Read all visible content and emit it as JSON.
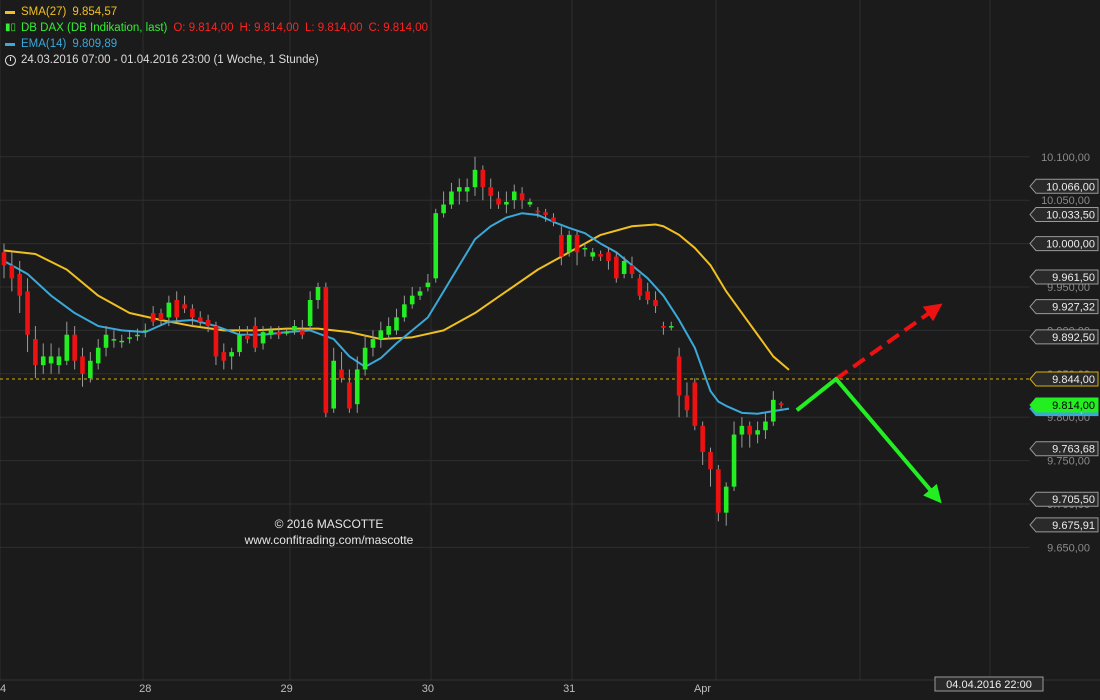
{
  "legend": {
    "sma_label": "SMA(27)",
    "sma_value": "9.854,57",
    "instrument": "DB DAX (DB Indikation, last)",
    "ohlc": {
      "open": "O: 9.814,00",
      "high": "H: 9.814,00",
      "low": "L: 9.814,00",
      "close": "C: 9.814,00"
    },
    "ema_label": "EMA(14)",
    "ema_value": "9.809,89",
    "range": "24.03.2016 07:00 - 01.04.2016 23:00 (1 Woche, 1 Stunde)"
  },
  "watermark": {
    "line1": "© 2016 MASCOTTE",
    "line2": "www.confitrading.com/mascotte"
  },
  "colors": {
    "background": "#1b1b1b",
    "up": "#22ee22",
    "down": "#ee1111",
    "sma": "#f0c020",
    "ema": "#3aa8d8",
    "reference_line": "#d9b000",
    "scenario_up": "#ee1111",
    "scenario_down": "#22ee22"
  },
  "chart_data": {
    "type": "candlestick",
    "ylim": [
      9630,
      10110
    ],
    "y_ticks": [
      {
        "value": 10100,
        "label": "10.100,00"
      },
      {
        "value": 10050,
        "label": "10.050,00"
      },
      {
        "value": 10000,
        "label": "10.000,00"
      },
      {
        "value": 9950,
        "label": "9.950,00"
      },
      {
        "value": 9900,
        "label": "9.900,00"
      },
      {
        "value": 9850,
        "label": "9.850,00"
      },
      {
        "value": 9800,
        "label": "9.800,00"
      },
      {
        "value": 9750,
        "label": "9.750,00"
      },
      {
        "value": 9700,
        "label": "9.700,00"
      },
      {
        "value": 9650,
        "label": "9.650,00"
      }
    ],
    "price_levels": [
      {
        "value": 10066,
        "label": "10.066,00"
      },
      {
        "value": 10033.5,
        "label": "10.033,50"
      },
      {
        "value": 10000,
        "label": "10.000,00"
      },
      {
        "value": 9961.5,
        "label": "9.961,50"
      },
      {
        "value": 9927.32,
        "label": "9.927,32"
      },
      {
        "value": 9892.5,
        "label": "9.892,50"
      },
      {
        "value": 9844,
        "label": "9.844,00"
      },
      {
        "value": 9809.91,
        "label": "9.809,91"
      },
      {
        "value": 9814,
        "label": "9.814,00"
      },
      {
        "value": 9763.68,
        "label": "9.763,68"
      },
      {
        "value": 9705.5,
        "label": "9.705,50"
      },
      {
        "value": 9675.91,
        "label": "9.675,91"
      }
    ],
    "x_labels": [
      {
        "index": 0,
        "label": "4"
      },
      {
        "index": 18,
        "label": "28"
      },
      {
        "index": 36,
        "label": "29"
      },
      {
        "index": 54,
        "label": "30"
      },
      {
        "index": 72,
        "label": "31"
      },
      {
        "index": 90,
        "label": "Apr"
      }
    ],
    "cursor_label": "04.04.2016 22:00",
    "reference_line": 9844,
    "candles": [
      [
        9990,
        9975,
        10000,
        9960
      ],
      [
        9975,
        9960,
        9990,
        9945
      ],
      [
        9965,
        9940,
        9980,
        9920
      ],
      [
        9945,
        9895,
        9960,
        9875
      ],
      [
        9890,
        9860,
        9905,
        9845
      ],
      [
        9860,
        9870,
        9885,
        9850
      ],
      [
        9862,
        9870,
        9885,
        9850
      ],
      [
        9860,
        9870,
        9880,
        9850
      ],
      [
        9865,
        9895,
        9910,
        9860
      ],
      [
        9895,
        9865,
        9905,
        9855
      ],
      [
        9870,
        9850,
        9880,
        9835
      ],
      [
        9845,
        9865,
        9875,
        9840
      ],
      [
        9862,
        9880,
        9890,
        9855
      ],
      [
        9880,
        9895,
        9905,
        9870
      ],
      [
        9890,
        9890,
        9900,
        9880
      ],
      [
        9888,
        9888,
        9895,
        9880
      ],
      [
        9892,
        9892,
        9900,
        9885
      ],
      [
        9895,
        9895,
        9902,
        9888
      ],
      [
        9900,
        9900,
        9908,
        9892
      ],
      [
        9920,
        9910,
        9928,
        9905
      ],
      [
        9920,
        9912,
        9925,
        9905
      ],
      [
        9915,
        9932,
        9940,
        9905
      ],
      [
        9935,
        9915,
        9945,
        9910
      ],
      [
        9930,
        9925,
        9940,
        9920
      ],
      [
        9925,
        9915,
        9930,
        9905
      ],
      [
        9915,
        9910,
        9922,
        9905
      ],
      [
        9912,
        9905,
        9918,
        9898
      ],
      [
        9905,
        9870,
        9910,
        9860
      ],
      [
        9875,
        9865,
        9885,
        9855
      ],
      [
        9870,
        9875,
        9880,
        9855
      ],
      [
        9875,
        9895,
        9905,
        9870
      ],
      [
        9895,
        9890,
        9905,
        9885
      ],
      [
        9905,
        9880,
        9915,
        9875
      ],
      [
        9885,
        9898,
        9905,
        9878
      ],
      [
        9895,
        9900,
        9905,
        9890
      ],
      [
        9898,
        9895,
        9905,
        9890
      ],
      [
        9898,
        9898,
        9902,
        9894
      ],
      [
        9900,
        9905,
        9912,
        9895
      ],
      [
        9900,
        9895,
        9912,
        9890
      ],
      [
        9905,
        9935,
        9945,
        9900
      ],
      [
        9935,
        9950,
        9955,
        9925
      ],
      [
        9950,
        9805,
        9955,
        9800
      ],
      [
        9810,
        9865,
        9880,
        9805
      ],
      [
        9855,
        9845,
        9875,
        9840
      ],
      [
        9840,
        9810,
        9855,
        9805
      ],
      [
        9815,
        9855,
        9870,
        9805
      ],
      [
        9855,
        9880,
        9895,
        9848
      ],
      [
        9880,
        9890,
        9900,
        9870
      ],
      [
        9890,
        9900,
        9910,
        9880
      ],
      [
        9895,
        9905,
        9915,
        9890
      ],
      [
        9900,
        9915,
        9925,
        9895
      ],
      [
        9915,
        9930,
        9940,
        9910
      ],
      [
        9930,
        9940,
        9950,
        9925
      ],
      [
        9940,
        9945,
        9950,
        9935
      ],
      [
        9950,
        9955,
        9965,
        9945
      ],
      [
        9960,
        10035,
        10040,
        9955
      ],
      [
        10035,
        10045,
        10060,
        10030
      ],
      [
        10045,
        10060,
        10070,
        10040
      ],
      [
        10060,
        10065,
        10075,
        10045
      ],
      [
        10060,
        10065,
        10075,
        10048
      ],
      [
        10065,
        10085,
        10100,
        10055
      ],
      [
        10085,
        10065,
        10090,
        10050
      ],
      [
        10065,
        10055,
        10075,
        10040
      ],
      [
        10052,
        10045,
        10060,
        10040
      ],
      [
        10045,
        10048,
        10060,
        10035
      ],
      [
        10050,
        10060,
        10068,
        10040
      ],
      [
        10058,
        10050,
        10065,
        10040
      ],
      [
        10045,
        10048,
        10052,
        10042
      ],
      [
        10038,
        10036,
        10042,
        10030
      ],
      [
        10036,
        10033,
        10040,
        10025
      ],
      [
        10030,
        10025,
        10035,
        10020
      ],
      [
        10010,
        9985,
        10020,
        9975
      ],
      [
        9990,
        10010,
        10015,
        9985
      ],
      [
        10010,
        9990,
        10015,
        9975
      ],
      [
        9995,
        9995,
        10000,
        9985
      ],
      [
        9985,
        9990,
        9995,
        9980
      ],
      [
        9988,
        9985,
        9992,
        9980
      ],
      [
        9990,
        9980,
        9995,
        9970
      ],
      [
        9985,
        9960,
        9990,
        9955
      ],
      [
        9965,
        9980,
        9985,
        9960
      ],
      [
        9975,
        9965,
        9985,
        9960
      ],
      [
        9960,
        9940,
        9965,
        9935
      ],
      [
        9945,
        9935,
        9955,
        9930
      ],
      [
        9935,
        9928,
        9945,
        9920
      ],
      [
        9905,
        9903,
        9910,
        9895
      ],
      [
        9905,
        9905,
        9910,
        9900
      ],
      [
        9870,
        9825,
        9880,
        9800
      ],
      [
        9825,
        9808,
        9840,
        9800
      ],
      [
        9840,
        9790,
        9845,
        9785
      ],
      [
        9790,
        9760,
        9795,
        9745
      ],
      [
        9760,
        9740,
        9765,
        9720
      ],
      [
        9740,
        9690,
        9745,
        9680
      ],
      [
        9690,
        9720,
        9725,
        9675
      ],
      [
        9720,
        9780,
        9795,
        9715
      ],
      [
        9780,
        9790,
        9800,
        9765
      ],
      [
        9790,
        9780,
        9795,
        9765
      ],
      [
        9780,
        9785,
        9795,
        9770
      ],
      [
        9785,
        9795,
        9805,
        9775
      ],
      [
        9795,
        9820,
        9830,
        9790
      ],
      [
        9816,
        9814,
        9818,
        9810
      ]
    ],
    "candle_width_days": 1,
    "sma": {
      "name": "SMA(27)",
      "points": [
        [
          0,
          9992
        ],
        [
          4,
          9988
        ],
        [
          8,
          9970
        ],
        [
          12,
          9940
        ],
        [
          16,
          9920
        ],
        [
          20,
          9912
        ],
        [
          24,
          9905
        ],
        [
          28,
          9900
        ],
        [
          32,
          9900
        ],
        [
          36,
          9902
        ],
        [
          40,
          9902
        ],
        [
          44,
          9898
        ],
        [
          48,
          9890
        ],
        [
          52,
          9892
        ],
        [
          56,
          9900
        ],
        [
          60,
          9920
        ],
        [
          64,
          9945
        ],
        [
          68,
          9970
        ],
        [
          72,
          9990
        ],
        [
          76,
          10010
        ],
        [
          80,
          10020
        ],
        [
          83,
          10022
        ],
        [
          84,
          10020
        ],
        [
          86,
          10010
        ],
        [
          88,
          9995
        ],
        [
          90,
          9975
        ],
        [
          92,
          9945
        ],
        [
          94,
          9920
        ],
        [
          96,
          9895
        ],
        [
          98,
          9870
        ],
        [
          100,
          9854.57
        ]
      ]
    },
    "ema": {
      "name": "EMA(14)",
      "points": [
        [
          0,
          9980
        ],
        [
          3,
          9965
        ],
        [
          6,
          9940
        ],
        [
          9,
          9920
        ],
        [
          12,
          9905
        ],
        [
          15,
          9900
        ],
        [
          18,
          9898
        ],
        [
          21,
          9910
        ],
        [
          24,
          9912
        ],
        [
          27,
          9905
        ],
        [
          30,
          9895
        ],
        [
          33,
          9895
        ],
        [
          36,
          9898
        ],
        [
          39,
          9900
        ],
        [
          42,
          9890
        ],
        [
          44,
          9870
        ],
        [
          46,
          9858
        ],
        [
          48,
          9868
        ],
        [
          50,
          9885
        ],
        [
          52,
          9900
        ],
        [
          54,
          9915
        ],
        [
          56,
          9945
        ],
        [
          58,
          9975
        ],
        [
          60,
          10005
        ],
        [
          62,
          10020
        ],
        [
          64,
          10030
        ],
        [
          66,
          10035
        ],
        [
          68,
          10033
        ],
        [
          70,
          10025
        ],
        [
          72,
          10018
        ],
        [
          74,
          10012
        ],
        [
          76,
          10000
        ],
        [
          78,
          9990
        ],
        [
          80,
          9975
        ],
        [
          82,
          9960
        ],
        [
          84,
          9940
        ],
        [
          86,
          9912
        ],
        [
          88,
          9880
        ],
        [
          89,
          9855
        ],
        [
          90,
          9830
        ],
        [
          91,
          9818
        ],
        [
          92,
          9813
        ],
        [
          94,
          9805
        ],
        [
          96,
          9804
        ],
        [
          98,
          9807
        ],
        [
          100,
          9809.89
        ]
      ]
    },
    "scenarios": [
      {
        "style": "dashed",
        "color": "#ee1111",
        "points": [
          [
            106,
            9844
          ],
          [
            119,
            9927.32
          ]
        ]
      },
      {
        "style": "solid",
        "color": "#22ee22",
        "points": [
          [
            101,
            9808
          ],
          [
            106,
            9844
          ],
          [
            119,
            9705.5
          ]
        ]
      }
    ]
  }
}
